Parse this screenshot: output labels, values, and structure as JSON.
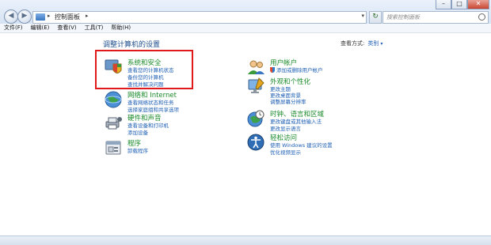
{
  "window": {
    "controls": [
      "–",
      "□",
      "✕"
    ]
  },
  "nav": {
    "back": "◀",
    "forward": "▶"
  },
  "address": {
    "sep1": "▸",
    "crumb": "控制面板",
    "sep2": "▸",
    "dropdown": "▾"
  },
  "refresh_icon": "↻",
  "search": {
    "placeholder": "搜索控制面板"
  },
  "menu": [
    "文件(F)",
    "编辑(E)",
    "查看(V)",
    "工具(T)",
    "帮助(H)"
  ],
  "page": {
    "title": "调整计算机的设置",
    "view_by_label": "查看方式:",
    "view_by_value": "类别",
    "view_by_caret": "▾"
  },
  "categories_left": [
    {
      "title": "系统和安全",
      "links": [
        "查看您的计算机状态",
        "备份您的计算机",
        "查找并解决问题"
      ],
      "icon": "system-security-icon"
    },
    {
      "title": "网络和 Internet",
      "links": [
        "查看网络状态和任务",
        "选择家庭组和共享选项"
      ],
      "icon": "network-internet-icon"
    },
    {
      "title": "硬件和声音",
      "links": [
        "查看设备和打印机",
        "添加设备"
      ],
      "icon": "hardware-sound-icon"
    },
    {
      "title": "程序",
      "links": [
        "卸载程序"
      ],
      "icon": "programs-icon"
    }
  ],
  "categories_right": [
    {
      "title": "用户帐户",
      "links": [
        "添加或删除用户帐户"
      ],
      "icon": "user-accounts-icon"
    },
    {
      "title": "外观和个性化",
      "links": [
        "更改主题",
        "更改桌面背景",
        "调整屏幕分辨率"
      ],
      "icon": "appearance-icon"
    },
    {
      "title": "时钟、语言和区域",
      "links": [
        "更改键盘或其他输入法",
        "更改显示语言"
      ],
      "icon": "clock-language-icon"
    },
    {
      "title": "轻松访问",
      "links": [
        "使用 Windows 建议的设置",
        "优化视频显示"
      ],
      "icon": "ease-of-access-icon"
    }
  ],
  "colors": {
    "category_title": "#1a8a2a",
    "link": "#1e5fb4",
    "highlight": "#e0191b"
  }
}
